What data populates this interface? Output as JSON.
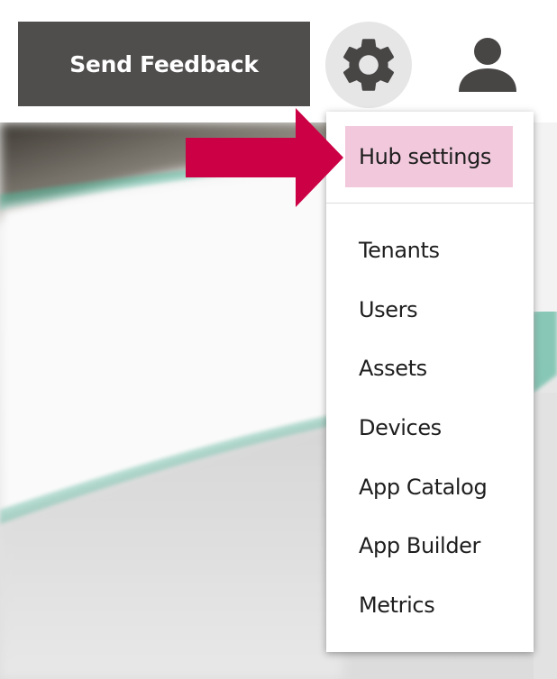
{
  "header": {
    "feedback_label": "Send Feedback"
  },
  "icons": {
    "settings": "gear-icon",
    "profile": "user-icon",
    "pointer": "arrow-right-icon"
  },
  "menu": {
    "items": [
      {
        "label": "Hub settings",
        "highlighted": true
      },
      {
        "label": "Tenants"
      },
      {
        "label": "Users"
      },
      {
        "label": "Assets"
      },
      {
        "label": "Devices"
      },
      {
        "label": "App Catalog"
      },
      {
        "label": "App Builder"
      },
      {
        "label": "Metrics"
      }
    ]
  },
  "colors": {
    "feedback_bg": "#504d4d",
    "gear_bg": "#e6e6e6",
    "icon_color": "#484545",
    "highlight_bg": "#f2c9dc",
    "arrow_color": "#cc0044"
  }
}
